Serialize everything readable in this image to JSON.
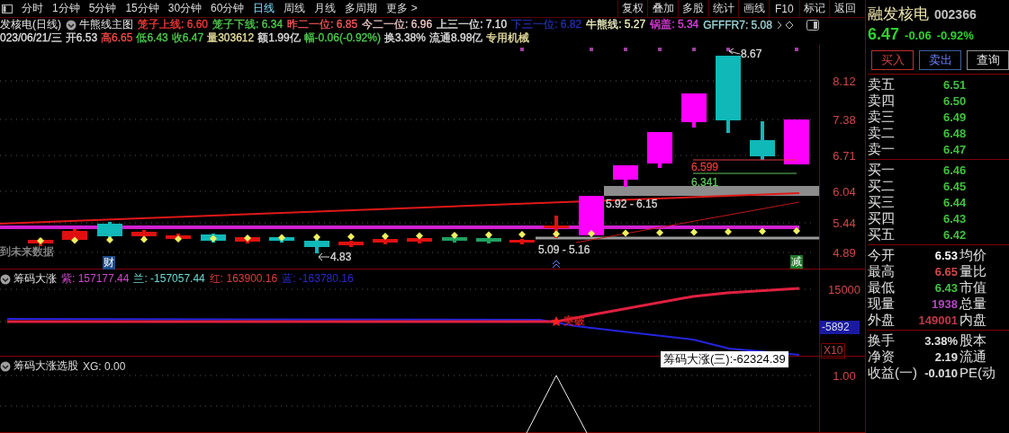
{
  "toolbar": {
    "periods": [
      {
        "label": "分时",
        "selected": false
      },
      {
        "label": "1分钟",
        "selected": false
      },
      {
        "label": "5分钟",
        "selected": false
      },
      {
        "label": "15分钟",
        "selected": false
      },
      {
        "label": "30分钟",
        "selected": false
      },
      {
        "label": "60分钟",
        "selected": false
      },
      {
        "label": "日线",
        "selected": true
      },
      {
        "label": "周线",
        "selected": false
      },
      {
        "label": "月线",
        "selected": false
      },
      {
        "label": "多周期",
        "selected": false
      },
      {
        "label": "更多 >",
        "selected": false
      }
    ],
    "actions": [
      "复权",
      "叠加",
      "多股",
      "统计",
      "画线",
      "F10",
      "标记",
      "返回"
    ]
  },
  "chart_header": {
    "title": "发核电(日线)",
    "indicator": "牛熊线主图",
    "values": [
      {
        "text": "笼子上线: 6.60",
        "color": "#ff3c3c"
      },
      {
        "text": "笼子下线: 6.34",
        "color": "#50d050"
      },
      {
        "text": "昨二一位: 6.85",
        "color": "#ff5a5a"
      },
      {
        "text": "今二一位: 6.96",
        "color": "#f0c8c8"
      },
      {
        "text": "上三一位: 7.10",
        "color": "#e8e8e8"
      },
      {
        "text": "下三一位: 6.82",
        "color": "#2430b0"
      },
      {
        "text": "牛熊线: 5.27",
        "color": "#f0f0c0"
      },
      {
        "text": "锅盖: 5.34",
        "color": "#e040e0"
      },
      {
        "text": "GFFFR7: 5.08",
        "color": "#a0d8d8"
      }
    ]
  },
  "quote_line": [
    {
      "text": "023/06/21/三",
      "color": "#e0e0e0"
    },
    {
      "text": "开6.53",
      "color": "#e0e0e0"
    },
    {
      "text": "高6.65",
      "color": "#ff4a4a"
    },
    {
      "text": "低6.43",
      "color": "#50d050"
    },
    {
      "text": "收6.47",
      "color": "#50d050"
    },
    {
      "text": "量303612",
      "color": "#e8e0a0"
    },
    {
      "text": "额1.99亿",
      "color": "#e0e0e0"
    },
    {
      "text": "幅-0.06(-0.92%)",
      "color": "#50d050"
    },
    {
      "text": "换3.38%",
      "color": "#e0e0e0"
    },
    {
      "text": "流通8.98亿",
      "color": "#e0e0e0"
    },
    {
      "text": "专用机械",
      "color": "#e8e0a0"
    }
  ],
  "main_chart": {
    "axis_labels": [
      "8.12",
      "7.38",
      "6.71",
      "6.04",
      "5.44",
      "4.89"
    ],
    "annotations": [
      {
        "text": "8.67",
        "color": "#d8d8d8"
      },
      {
        "text": "6.599",
        "color": "#e03c3c"
      },
      {
        "text": "6.341",
        "color": "#5ec85e"
      },
      {
        "text": "5.92 - 6.15",
        "color": "#d8d8d8"
      },
      {
        "text": "5.09 - 5.16",
        "color": "#d8d8d8"
      },
      {
        "text": "4.83",
        "color": "#d8d8d8"
      }
    ],
    "note": "到未来数据",
    "badges": [
      {
        "text": "财",
        "color": "#1c4c8c"
      },
      {
        "text": "减",
        "color": "#1e7a2a"
      }
    ]
  },
  "indicator_1": {
    "name": "筹码大涨",
    "values": [
      {
        "text": "紫: 157177.44",
        "color": "#d048d0"
      },
      {
        "text": "兰: -157057.44",
        "color": "#70d8d0"
      },
      {
        "text": "红: 163900.16",
        "color": "#e03c3c"
      },
      {
        "text": "蓝: -163780.16",
        "color": "#2a2ac8"
      }
    ],
    "axis_labels": [
      "15000"
    ],
    "current_value": "-5892",
    "scale": "X10",
    "signal": "突破",
    "tooltip": "筹码大涨(三):-62324.39"
  },
  "indicator_2": {
    "name": "筹码大涨选股",
    "values": [
      {
        "text": "XG: 0.00",
        "color": "#d8d8d8"
      }
    ],
    "axis_labels": [
      "1.00"
    ]
  },
  "quote": {
    "name": "融发核电",
    "code": "002366",
    "price": "6.47",
    "change": "-0.06",
    "change_pct": "-0.92%",
    "buttons": [
      {
        "label": "买入",
        "kind": "buy"
      },
      {
        "label": "卖出",
        "kind": "sell"
      },
      {
        "label": "查询",
        "kind": "query"
      }
    ],
    "asks": [
      {
        "label": "卖五",
        "price": "6.51"
      },
      {
        "label": "卖四",
        "price": "6.50"
      },
      {
        "label": "卖三",
        "price": "6.49"
      },
      {
        "label": "卖二",
        "price": "6.48"
      },
      {
        "label": "卖一",
        "price": "6.47"
      }
    ],
    "bids": [
      {
        "label": "买一",
        "price": "6.46"
      },
      {
        "label": "买二",
        "price": "6.45"
      },
      {
        "label": "买三",
        "price": "6.44"
      },
      {
        "label": "买四",
        "price": "6.43"
      },
      {
        "label": "买五",
        "price": "6.42"
      }
    ],
    "stats": [
      {
        "label": "今开",
        "value": "6.53",
        "label_2": "均价",
        "color": "#ffffff"
      },
      {
        "label": "最高",
        "value": "6.65",
        "label_2": "量比",
        "color": "#d04848"
      },
      {
        "label": "最低",
        "value": "6.43",
        "label_2": "市值",
        "color": "#48c048"
      },
      {
        "label": "现量",
        "value": "1938",
        "label_2": "总量",
        "color": "#b048c0"
      },
      {
        "label": "外盘",
        "value": "149001",
        "label_2": "内盘",
        "color": "#c03848"
      }
    ],
    "fundamentals": [
      {
        "label": "换手",
        "value": "3.38%",
        "label_2": "股本"
      },
      {
        "label": "净资",
        "value": "2.19",
        "label_2": "流通"
      },
      {
        "label": "收益(一)",
        "value": "-0.010",
        "label_2": "PE(动"
      }
    ]
  }
}
